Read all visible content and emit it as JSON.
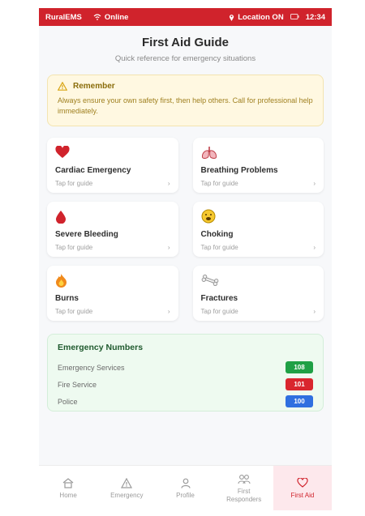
{
  "statusbar": {
    "app": "RuralEMS",
    "online": "Online",
    "location": "Location ON",
    "time": "12:34"
  },
  "header": {
    "title": "First Aid Guide",
    "subtitle": "Quick reference for emergency situations"
  },
  "remember": {
    "title": "Remember",
    "body": "Always ensure your own safety first, then help others. Call for professional help immediately."
  },
  "cards": [
    {
      "label": "Cardiac Emergency",
      "tap": "Tap for guide",
      "icon": "heart-icon"
    },
    {
      "label": "Breathing Problems",
      "tap": "Tap for guide",
      "icon": "lungs-icon"
    },
    {
      "label": "Severe Bleeding",
      "tap": "Tap for guide",
      "icon": "blood-drop-icon"
    },
    {
      "label": "Choking",
      "tap": "Tap for guide",
      "icon": "choking-face-icon"
    },
    {
      "label": "Burns",
      "tap": "Tap for guide",
      "icon": "fire-icon"
    },
    {
      "label": "Fractures",
      "tap": "Tap for guide",
      "icon": "bone-icon"
    }
  ],
  "emergency": {
    "title": "Emergency Numbers",
    "rows": [
      {
        "label": "Emergency Services",
        "number": "108",
        "color": "#1fa045"
      },
      {
        "label": "Fire Service",
        "number": "101",
        "color": "#d9262e"
      },
      {
        "label": "Police",
        "number": "100",
        "color": "#2f6fe0"
      }
    ]
  },
  "nav": {
    "items": [
      {
        "label": "Home",
        "icon": "home-icon"
      },
      {
        "label": "Emergency",
        "icon": "warning-icon"
      },
      {
        "label": "Profile",
        "icon": "person-icon"
      },
      {
        "label": "First Responders",
        "icon": "group-icon"
      },
      {
        "label": "First Aid",
        "icon": "heart-outline-icon"
      }
    ],
    "active": "First Aid"
  },
  "colors": {
    "accent": "#d0232c",
    "warning_bg": "#fff8e1",
    "emergency_bg": "#eefaf0"
  }
}
